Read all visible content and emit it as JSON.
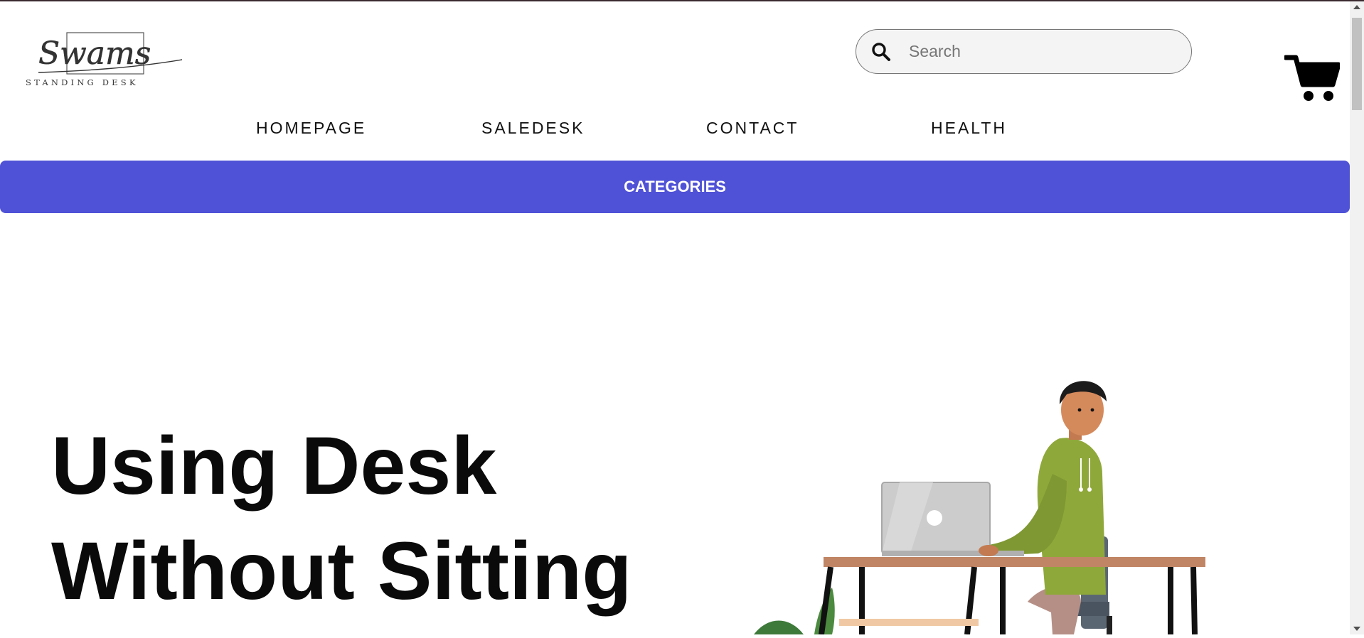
{
  "brand": {
    "logo_script": "Swams",
    "logo_tagline": "STANDING DESK"
  },
  "search": {
    "placeholder": "Search",
    "value": ""
  },
  "nav": {
    "items": [
      {
        "label": "HOMEPAGE"
      },
      {
        "label": "SALEDESK"
      },
      {
        "label": "CONTACT"
      },
      {
        "label": "HEALTH"
      }
    ]
  },
  "categories_label": "CATEGORIES",
  "hero": {
    "line1": "Using Desk",
    "line2": "Without Sitting"
  },
  "colors": {
    "accent": "#4f51d6",
    "hoodie": "#8fa83a",
    "desk": "#c08565",
    "laptop": "#cccccc"
  },
  "icons": [
    "search-icon",
    "cart-icon"
  ]
}
